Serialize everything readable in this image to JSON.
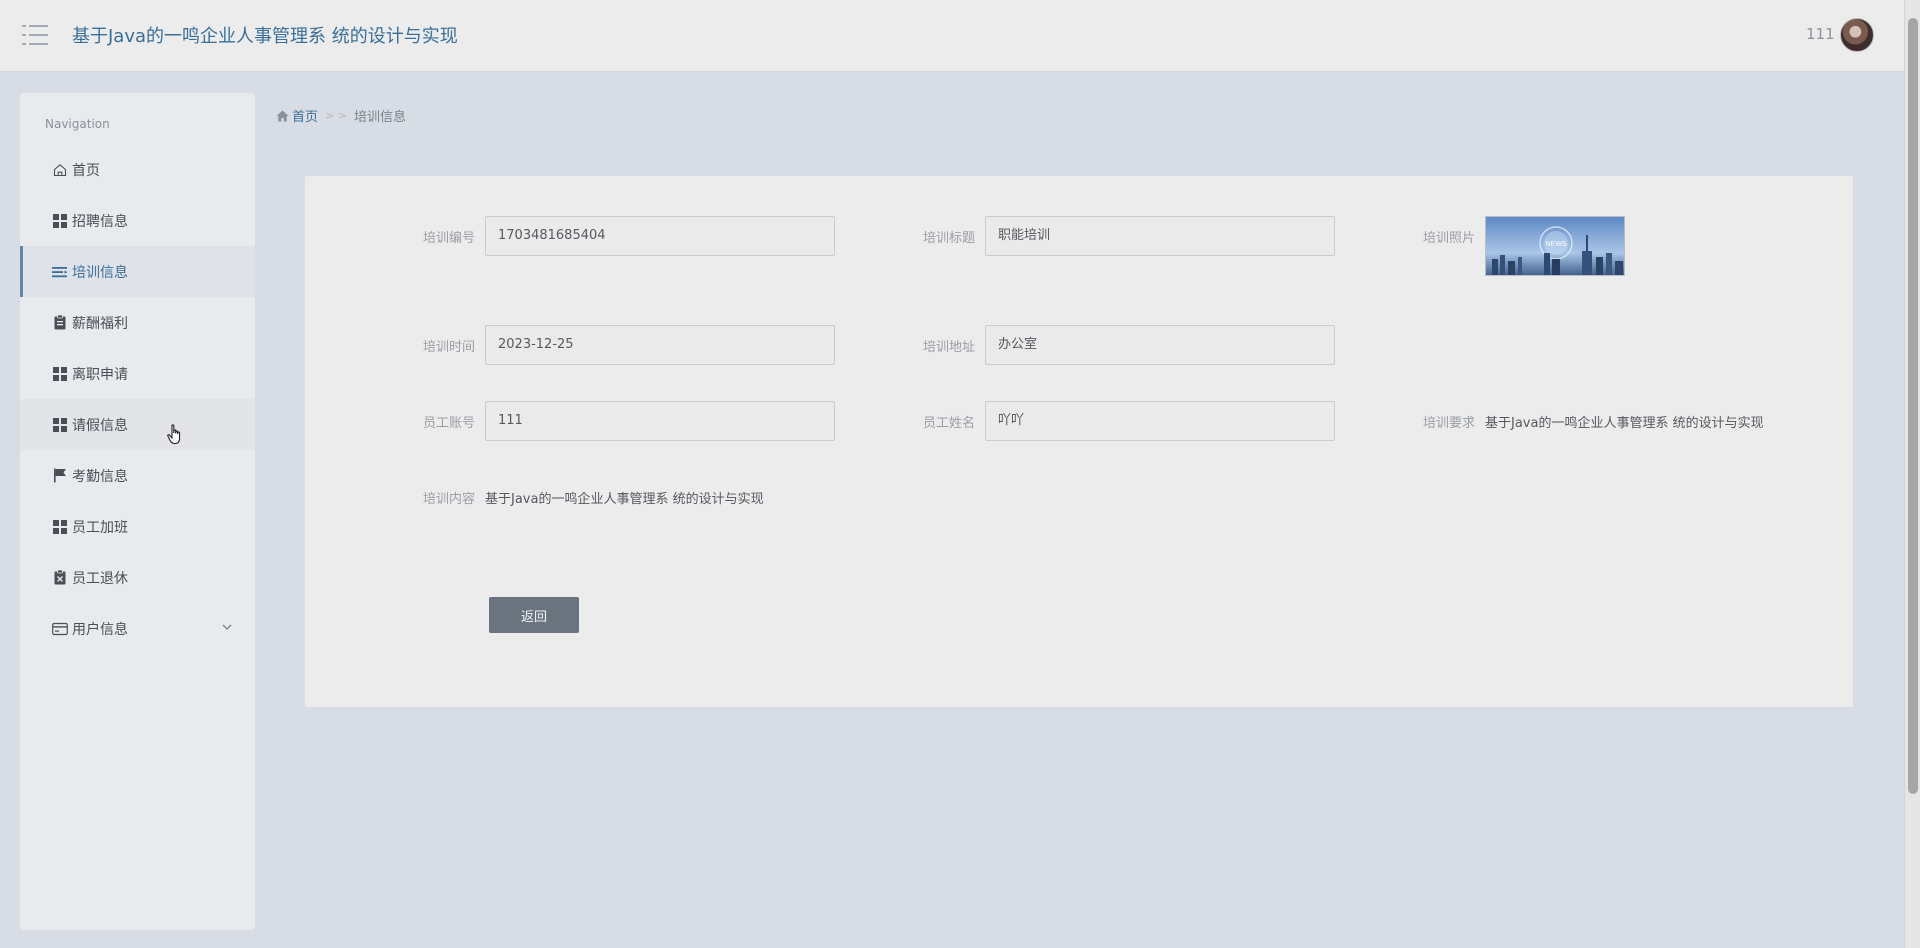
{
  "header": {
    "title": "基于Java的一鸣企业人事管理系 统的设计与实现",
    "username": "111"
  },
  "sidebar": {
    "heading": "Navigation",
    "items": [
      {
        "label": "首页",
        "icon": "home-icon"
      },
      {
        "label": "招聘信息",
        "icon": "grid-icon"
      },
      {
        "label": "培训信息",
        "icon": "list-icon",
        "active": true
      },
      {
        "label": "薪酬福利",
        "icon": "clipboard-icon"
      },
      {
        "label": "离职申请",
        "icon": "grid-icon"
      },
      {
        "label": "请假信息",
        "icon": "grid-icon"
      },
      {
        "label": "考勤信息",
        "icon": "flag-icon"
      },
      {
        "label": "员工加班",
        "icon": "grid-icon"
      },
      {
        "label": "员工退休",
        "icon": "clipboard-x-icon"
      },
      {
        "label": "用户信息",
        "icon": "wallet-icon",
        "expandable": true
      }
    ]
  },
  "breadcrumb": {
    "home": "首页",
    "separator": "> >",
    "current": "培训信息"
  },
  "form": {
    "training_no": {
      "label": "培训编号",
      "value": "1703481685404"
    },
    "training_title": {
      "label": "培训标题",
      "value": "职能培训"
    },
    "training_photo": {
      "label": "培训照片",
      "image_text": "NEWS"
    },
    "training_time": {
      "label": "培训时间",
      "value": "2023-12-25"
    },
    "training_address": {
      "label": "培训地址",
      "value": "办公室"
    },
    "employee_account": {
      "label": "员工账号",
      "value": "111"
    },
    "employee_name": {
      "label": "员工姓名",
      "value": "吖吖"
    },
    "training_requirement": {
      "label": "培训要求",
      "value": "基于Java的一鸣企业人事管理系 统的设计与实现"
    },
    "training_content": {
      "label": "培训内容",
      "value": "基于Java的一鸣企业人事管理系 统的设计与实现"
    },
    "back_label": "返回"
  },
  "colors": {
    "accent": "#3a6f9a",
    "active_bar": "#5a87ad",
    "button": "#6a747e"
  }
}
